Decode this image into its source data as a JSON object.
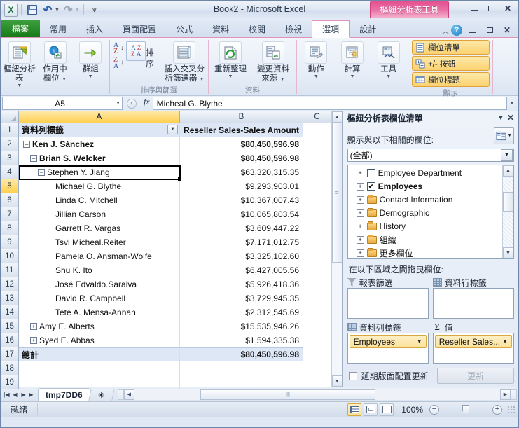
{
  "titlebar": {
    "document_title": "Book2  -  Microsoft Excel",
    "contextual_tab_group": "樞紐分析表工具",
    "quick_access": {
      "save_tooltip": "儲存",
      "undo_tooltip": "復原",
      "redo_tooltip": "取消復原",
      "customize_tooltip": "自訂快速存取工具列"
    },
    "window_buttons": {
      "minimize": "—",
      "maximize": "□",
      "close": "✕"
    }
  },
  "tabs": [
    {
      "label": "檔案",
      "active": false,
      "kind": "file"
    },
    {
      "label": "常用",
      "active": false,
      "kind": "normal"
    },
    {
      "label": "插入",
      "active": false,
      "kind": "normal"
    },
    {
      "label": "頁面配置",
      "active": false,
      "kind": "normal"
    },
    {
      "label": "公式",
      "active": false,
      "kind": "normal"
    },
    {
      "label": "資料",
      "active": false,
      "kind": "normal"
    },
    {
      "label": "校閱",
      "active": false,
      "kind": "normal"
    },
    {
      "label": "檢視",
      "active": false,
      "kind": "normal"
    },
    {
      "label": "選項",
      "active": true,
      "kind": "contextual"
    },
    {
      "label": "設計",
      "active": false,
      "kind": "contextual"
    }
  ],
  "ribbon": {
    "groups": [
      {
        "label": "",
        "buttons": [
          {
            "label": "樞紐分析表",
            "icon": "pivottable-icon",
            "has_dropdown": true
          },
          {
            "label": "作用中\n欄位",
            "label_line1": "作用中",
            "label_line2": "欄位",
            "icon": "active-field-icon",
            "has_dropdown": true
          },
          {
            "label": "群組",
            "icon": "group-icon",
            "has_dropdown": true
          }
        ]
      },
      {
        "label": "排序與篩選",
        "sort_asc": "A→Z",
        "sort_desc": "Z→A",
        "sort_label": "排序",
        "slicer_line1": "插入交叉分",
        "slicer_line2": "析篩選器"
      },
      {
        "label": "資料",
        "refresh": "重新整理",
        "change_source_line1": "變更資料",
        "change_source_line2": "來源"
      },
      {
        "label": "",
        "buttons": [
          {
            "label": "動作",
            "icon": "actions-icon",
            "has_dropdown": true
          },
          {
            "label": "計算",
            "icon": "calculations-icon",
            "has_dropdown": true
          },
          {
            "label": "工具",
            "icon": "tools-icon",
            "has_dropdown": true
          }
        ]
      },
      {
        "label": "顯示",
        "toggles": [
          {
            "label": "欄位清單",
            "icon": "field-list-icon",
            "pressed": true
          },
          {
            "label": "+/- 按鈕",
            "icon": "plus-minus-icon",
            "pressed": true
          },
          {
            "label": "欄位標題",
            "icon": "field-headers-icon",
            "pressed": true
          }
        ]
      }
    ]
  },
  "formulabar": {
    "name_box": "A5",
    "formula": "Micheal G. Blythe"
  },
  "grid": {
    "columns": [
      "A",
      "B",
      "C"
    ],
    "selected_column": "A",
    "selected_row": 5,
    "rows": [
      {
        "n": 1,
        "a": "資料列標籤",
        "b": "Reseller Sales-Sales Amount",
        "style": "header",
        "indent": 0,
        "toggle": "",
        "filter": true
      },
      {
        "n": 2,
        "a": "Ken J. Sánchez",
        "b": "$80,450,596.98",
        "style": "bold",
        "indent": 0,
        "toggle": "minus"
      },
      {
        "n": 3,
        "a": "Brian S. Welcker",
        "b": "$80,450,596.98",
        "style": "bold",
        "indent": 1,
        "toggle": "minus"
      },
      {
        "n": 4,
        "a": "Stephen Y. Jiang",
        "b": "$63,320,315.35",
        "style": "normal",
        "indent": 2,
        "toggle": "minus"
      },
      {
        "n": 5,
        "a": "Michael G. Blythe",
        "b": "$9,293,903.01",
        "style": "normal",
        "indent": 3,
        "toggle": ""
      },
      {
        "n": 6,
        "a": "Linda C. Mitchell",
        "b": "$10,367,007.43",
        "style": "normal",
        "indent": 3,
        "toggle": ""
      },
      {
        "n": 7,
        "a": "Jillian Carson",
        "b": "$10,065,803.54",
        "style": "normal",
        "indent": 3,
        "toggle": ""
      },
      {
        "n": 8,
        "a": "Garrett R. Vargas",
        "b": "$3,609,447.22",
        "style": "normal",
        "indent": 3,
        "toggle": ""
      },
      {
        "n": 9,
        "a": "Tsvi Micheal.Reiter",
        "b": "$7,171,012.75",
        "style": "normal",
        "indent": 3,
        "toggle": ""
      },
      {
        "n": 10,
        "a": "Pamela O. Ansman-Wolfe",
        "b": "$3,325,102.60",
        "style": "normal",
        "indent": 3,
        "toggle": ""
      },
      {
        "n": 11,
        "a": "Shu K. Ito",
        "b": "$6,427,005.56",
        "style": "normal",
        "indent": 3,
        "toggle": ""
      },
      {
        "n": 12,
        "a": "José Edvaldo.Saraiva",
        "b": "$5,926,418.36",
        "style": "normal",
        "indent": 3,
        "toggle": ""
      },
      {
        "n": 13,
        "a": "David R. Campbell",
        "b": "$3,729,945.35",
        "style": "normal",
        "indent": 3,
        "toggle": ""
      },
      {
        "n": 14,
        "a": "Tete A. Mensa-Annan",
        "b": "$2,312,545.69",
        "style": "normal",
        "indent": 3,
        "toggle": ""
      },
      {
        "n": 15,
        "a": "Amy E. Alberts",
        "b": "$15,535,946.26",
        "style": "normal",
        "indent": 1,
        "toggle": "plus"
      },
      {
        "n": 16,
        "a": "Syed E. Abbas",
        "b": "$1,594,335.38",
        "style": "normal",
        "indent": 1,
        "toggle": "plus"
      },
      {
        "n": 17,
        "a": "總計",
        "b": "$80,450,596.98",
        "style": "total",
        "indent": 0,
        "toggle": ""
      },
      {
        "n": 18,
        "a": "",
        "b": "",
        "style": "normal",
        "indent": 0,
        "toggle": ""
      },
      {
        "n": 19,
        "a": "",
        "b": "",
        "style": "normal",
        "indent": 0,
        "toggle": ""
      }
    ]
  },
  "pivot_panel": {
    "title": "樞紐分析表欄位清單",
    "dropdown_glyph": "▼",
    "close_glyph": "✕",
    "show_fields_label": "顯示與以下相關的欄位:",
    "scope_select_value": "(全部)",
    "fields": [
      {
        "label": "Employee Department",
        "kind": "checkbox",
        "checked": false,
        "bold": false
      },
      {
        "label": "Employees",
        "kind": "checkbox",
        "checked": true,
        "bold": true
      },
      {
        "label": "Contact Information",
        "kind": "folder",
        "checked": false,
        "bold": false
      },
      {
        "label": "Demographic",
        "kind": "folder",
        "checked": false,
        "bold": false
      },
      {
        "label": "History",
        "kind": "folder",
        "checked": false,
        "bold": false
      },
      {
        "label": "組織",
        "kind": "folder",
        "checked": false,
        "bold": false
      },
      {
        "label": "更多欄位",
        "kind": "folder-more",
        "checked": false,
        "bold": false
      }
    ],
    "areas_label": "在以下區域之間拖曳欄位:",
    "areas": [
      {
        "name": "報表篩選",
        "icon": "report-filter-icon",
        "chips": []
      },
      {
        "name": "資料行標籤",
        "icon": "column-labels-icon",
        "chips": []
      },
      {
        "name": "資料列標籤",
        "icon": "row-labels-icon",
        "chips": [
          "Employees"
        ]
      },
      {
        "name": "值",
        "icon": "sigma-icon",
        "chips": [
          "Reseller Sales..."
        ]
      }
    ],
    "defer_label": "延期版面配置更新",
    "defer_checked": false,
    "update_button": "更新",
    "update_enabled": false
  },
  "sheetbar": {
    "nav_first": "|◀",
    "nav_prev": "◀",
    "nav_next": "▶",
    "nav_last": "▶|",
    "tabs": [
      {
        "label": "tmp7DD6",
        "active": true
      }
    ],
    "new_sheet_tooltip": "插入工作表"
  },
  "statusbar": {
    "status_text": "就緒",
    "views": [
      {
        "name": "normal-view",
        "active": true
      },
      {
        "name": "page-layout-view",
        "active": false
      },
      {
        "name": "page-break-view",
        "active": false
      }
    ],
    "zoom_level": "100%",
    "zoom_out": "−",
    "zoom_in": "+"
  },
  "colors": {
    "file_tab_green": "#177a17",
    "contextual_pink": "#e5508f",
    "selection_yellow": "#fdd04f",
    "chip_orange": "#fbe29a"
  }
}
